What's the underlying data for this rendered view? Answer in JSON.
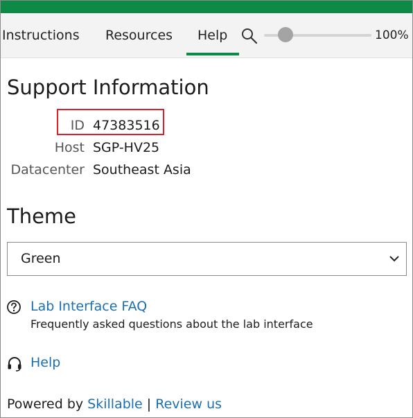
{
  "colors": {
    "accent": "#0e8a47",
    "highlight": "#e0212c",
    "link": "#1a6fb0"
  },
  "tabs": [
    {
      "label": "Instructions",
      "active": false
    },
    {
      "label": "Resources",
      "active": false
    },
    {
      "label": "Help",
      "active": true
    }
  ],
  "zoom": {
    "icon": "magnifier-icon",
    "value_fraction": 0.2,
    "label": "100%"
  },
  "support": {
    "title": "Support Information",
    "rows": [
      {
        "label": "ID",
        "value": "47383516"
      },
      {
        "label": "Host",
        "value": "SGP-HV25"
      },
      {
        "label": "Datacenter",
        "value": "Southeast Asia"
      }
    ]
  },
  "theme": {
    "title": "Theme",
    "selected": "Green"
  },
  "faq": {
    "icon": "question-circle-icon",
    "label": "Lab Interface FAQ",
    "description": "Frequently asked questions about the lab interface"
  },
  "help": {
    "icon": "headset-icon",
    "label": "Help"
  },
  "footer": {
    "prefix": "Powered by",
    "brand": "Skillable",
    "separator": "|",
    "review": "Review us"
  }
}
